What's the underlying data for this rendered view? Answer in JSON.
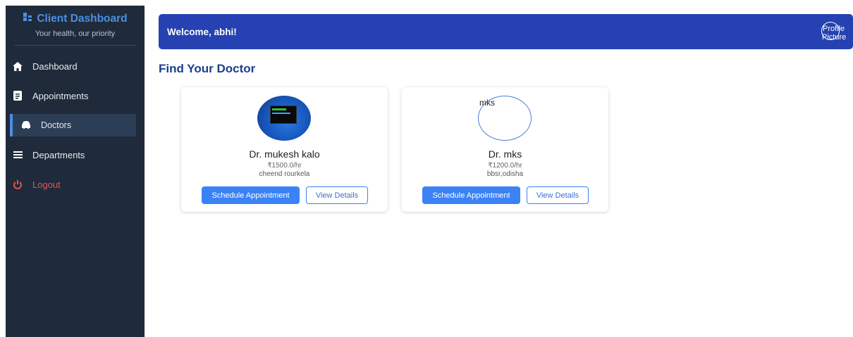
{
  "sidebar": {
    "brand_title": "Client Dashboard",
    "brand_subtitle": "Your health, our priority",
    "items": [
      {
        "label": "Dashboard",
        "icon": "home-icon"
      },
      {
        "label": "Appointments",
        "icon": "document-icon"
      },
      {
        "label": "Doctors",
        "icon": "car-icon"
      },
      {
        "label": "Departments",
        "icon": "menu-icon"
      },
      {
        "label": "Logout",
        "icon": "power-icon"
      }
    ],
    "active_item": "Doctors"
  },
  "header": {
    "welcome_text": "Welcome, abhi!",
    "profile_alt_line1": "Profile",
    "profile_alt_line2": "Picture"
  },
  "main": {
    "section_title": "Find Your Doctor",
    "doctors": [
      {
        "name": "Dr. mukesh kalo",
        "fee": "₹1500.0/hr",
        "location": "cheend rourkela",
        "avatar_alt": "",
        "schedule_label": "Schedule Appointment",
        "details_label": "View Details"
      },
      {
        "name": "Dr. mks",
        "fee": "₹1200.0/hr",
        "location": "bbsr,odisha",
        "avatar_alt": "mks",
        "schedule_label": "Schedule Appointment",
        "details_label": "View Details"
      }
    ]
  },
  "colors": {
    "sidebar_bg": "#1f2a3a",
    "header_bg": "#2541b2",
    "accent": "#3b82f6",
    "logout": "#e25555",
    "title": "#1e3c8f"
  }
}
